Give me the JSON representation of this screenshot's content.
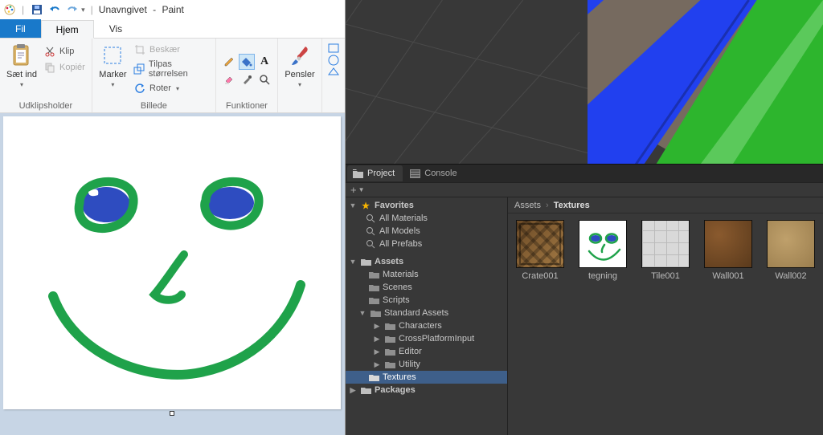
{
  "paint": {
    "title_doc": "Unavngivet",
    "title_app": "Paint",
    "tabs": {
      "file": "Fil",
      "home": "Hjem",
      "view": "Vis"
    },
    "groups": {
      "clipboard": {
        "label": "Udklipsholder",
        "paste": "Sæt ind",
        "cut": "Klip",
        "copy": "Kopiér"
      },
      "image": {
        "label": "Billede",
        "select": "Marker",
        "crop": "Beskær",
        "resize": "Tilpas størrelsen",
        "rotate": "Roter"
      },
      "tools": {
        "label": "Funktioner"
      },
      "brushes": {
        "label": "Pensler"
      }
    }
  },
  "unity": {
    "tabs": {
      "project": "Project",
      "console": "Console"
    },
    "favorites": {
      "header": "Favorites",
      "items": [
        "All Materials",
        "All Models",
        "All Prefabs"
      ]
    },
    "assets_header": "Assets",
    "assets_tree": {
      "materials": "Materials",
      "scenes": "Scenes",
      "scripts": "Scripts",
      "standard": "Standard Assets",
      "standard_children": [
        "Characters",
        "CrossPlatformInput",
        "Editor",
        "Utility"
      ],
      "textures": "Textures"
    },
    "packages_header": "Packages",
    "breadcrumb": {
      "root": "Assets",
      "current": "Textures"
    },
    "grid": [
      {
        "name": "Crate001",
        "kind": "crate"
      },
      {
        "name": "tegning",
        "kind": "tegning"
      },
      {
        "name": "Tile001",
        "kind": "tile"
      },
      {
        "name": "Wall001",
        "kind": "wall1"
      },
      {
        "name": "Wall002",
        "kind": "wall2"
      }
    ]
  }
}
